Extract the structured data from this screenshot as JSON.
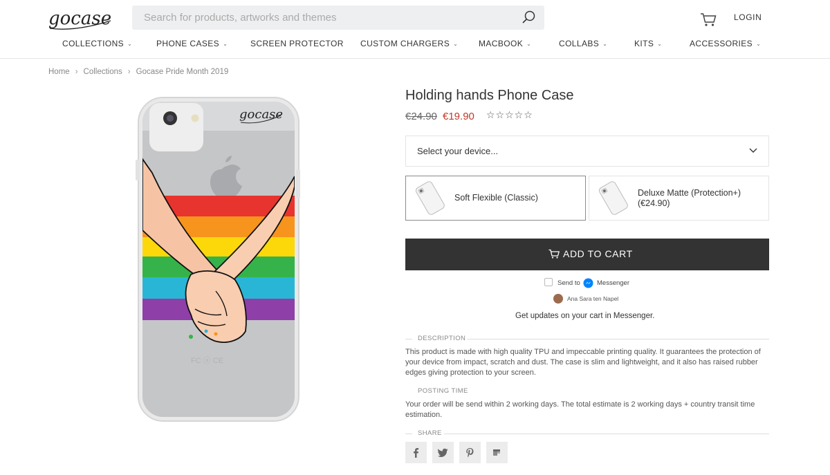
{
  "header": {
    "logo_text": "gocase",
    "search_placeholder": "Search for products, artworks and themes",
    "login_label": "LOGIN"
  },
  "nav": {
    "items": [
      {
        "label": "COLLECTIONS",
        "has_dropdown": true
      },
      {
        "label": "PHONE CASES",
        "has_dropdown": true
      },
      {
        "label": "SCREEN PROTECTOR",
        "has_dropdown": false
      },
      {
        "label": "CUSTOM CHARGERS",
        "has_dropdown": true
      },
      {
        "label": "MACBOOK",
        "has_dropdown": true
      },
      {
        "label": "COLLABS",
        "has_dropdown": true
      },
      {
        "label": "KITS",
        "has_dropdown": true
      },
      {
        "label": "ACCESSORIES",
        "has_dropdown": true
      }
    ]
  },
  "breadcrumb": {
    "items": [
      "Home",
      "Collections",
      "Gocase Pride Month 2019"
    ],
    "separator": "›"
  },
  "product": {
    "title": "Holding hands Phone Case",
    "price_old": "€24.90",
    "price_new": "€19.90",
    "rating_stars": "☆☆☆☆☆",
    "rating_value": 0,
    "rating_max": 5,
    "device_select_placeholder": "Select your device...",
    "options": [
      {
        "label": "Soft Flexible (Classic)",
        "selected": true
      },
      {
        "label_line1": "Deluxe Matte (Protection+)",
        "label_line2": "(€24.90)",
        "selected": false
      }
    ],
    "add_to_cart_label": "ADD TO CART",
    "image_logo_text": "gocase",
    "rainbow_colors": [
      "#e8342e",
      "#f7941d",
      "#fcd80a",
      "#35b34a",
      "#29b6d6",
      "#8e3fa8"
    ]
  },
  "messenger": {
    "send_to_label": "Send to",
    "brand_label": "Messenger",
    "user_name": "Ana Sara ten Napel",
    "updates_text": "Get updates on your cart in Messenger."
  },
  "sections": {
    "description_title": "DESCRIPTION",
    "description_text": "This product is made with high quality TPU and impeccable printing quality. It guarantees the protection of your device from impact, scratch and dust. The case is slim and lightweight, and it also has raised rubber edges giving protection to your screen.",
    "posting_title": "POSTING TIME",
    "posting_text": "Your order will be send within 2 working days. The total estimate is 2 working days + country transit time estimation.",
    "share_title": "SHARE"
  },
  "share_buttons": [
    "facebook-icon",
    "twitter-icon",
    "pinterest-icon",
    "tumblr-icon"
  ],
  "colors": {
    "accent_dark": "#333333",
    "sale_red": "#c0392b",
    "search_bg": "#eeeff1",
    "share_bg": "#ececec"
  }
}
